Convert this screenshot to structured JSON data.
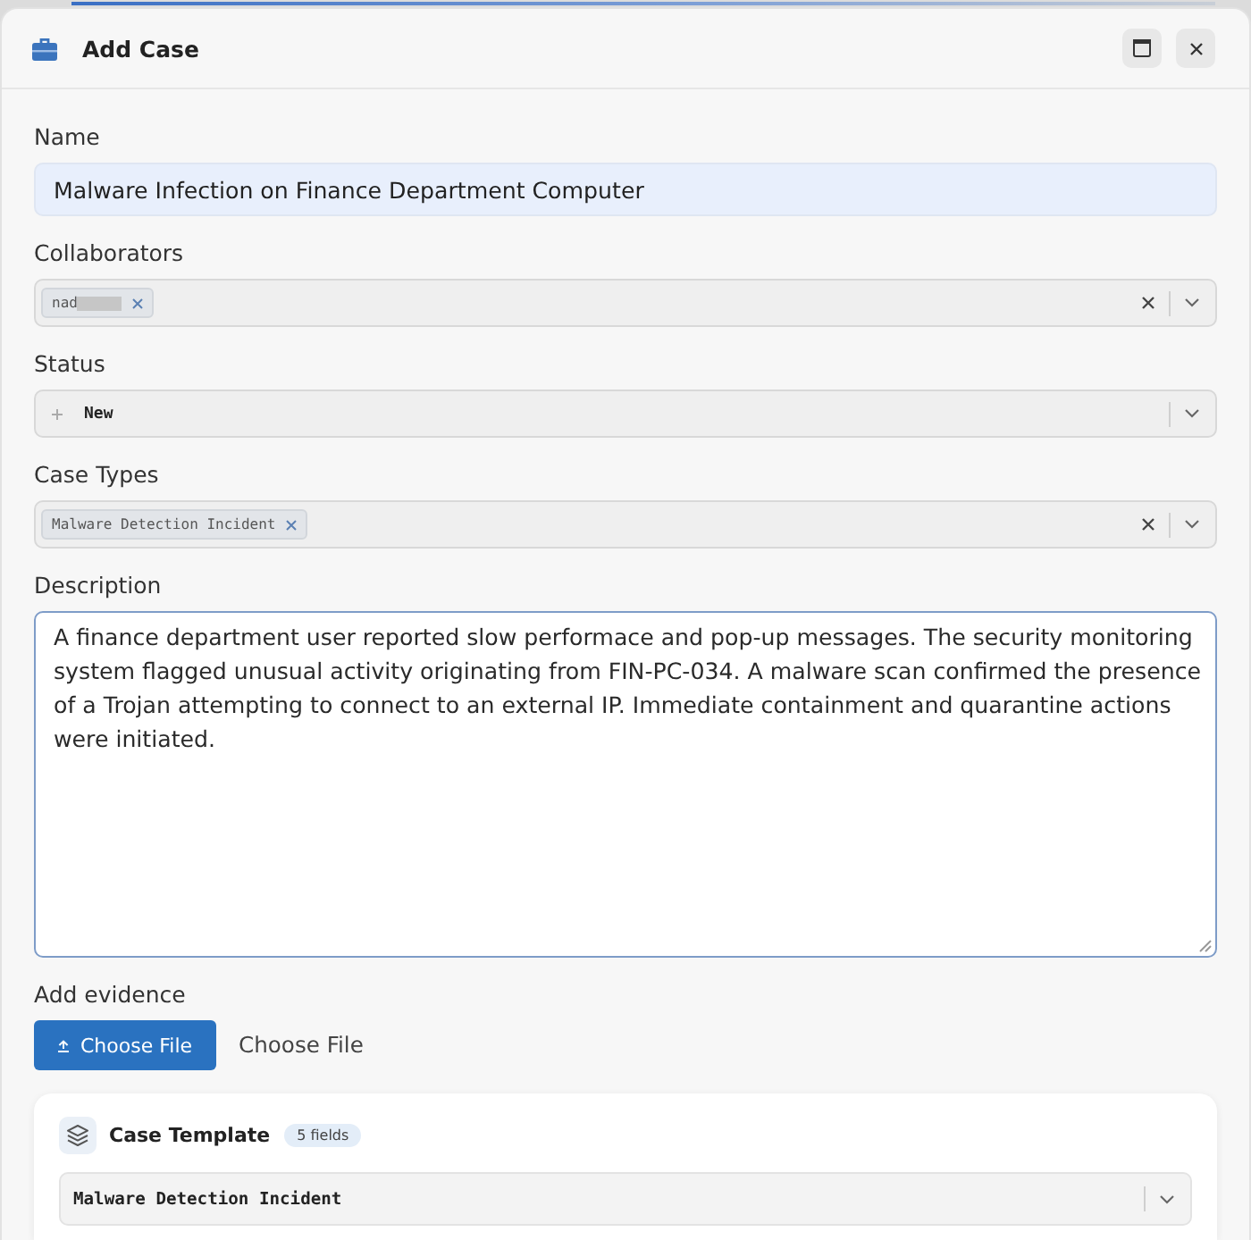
{
  "window": {
    "title": "Add Case"
  },
  "fields": [
    {
      "kind": "text",
      "label": "Name",
      "value": "Malware Infection on Finance Department Computer",
      "autofilled": true
    },
    {
      "kind": "multiselect",
      "label": "Collaborators",
      "chips": [
        {
          "label": "nad",
          "redacted": true
        }
      ]
    },
    {
      "kind": "select",
      "label": "Status",
      "value": "New"
    },
    {
      "kind": "multiselect",
      "label": "Case Types",
      "chips": [
        {
          "label": "Malware Detection Incident",
          "redacted": false
        }
      ]
    },
    {
      "kind": "textarea",
      "label": "Description",
      "value": "A finance department user reported slow performace and pop-up messages. The security monitoring system flagged unusual activity originating from FIN-PC-034. A malware scan confirmed the presence of a Trojan attempting to connect to an external IP. Immediate containment and quarantine actions were initiated.",
      "focused": true
    }
  ],
  "evidence": {
    "label": "Add evidence",
    "button": "Choose File",
    "file_name": "Choose File"
  },
  "template_card": {
    "title": "Case Template",
    "badge": "5 fields",
    "value": "Malware Detection Incident"
  }
}
